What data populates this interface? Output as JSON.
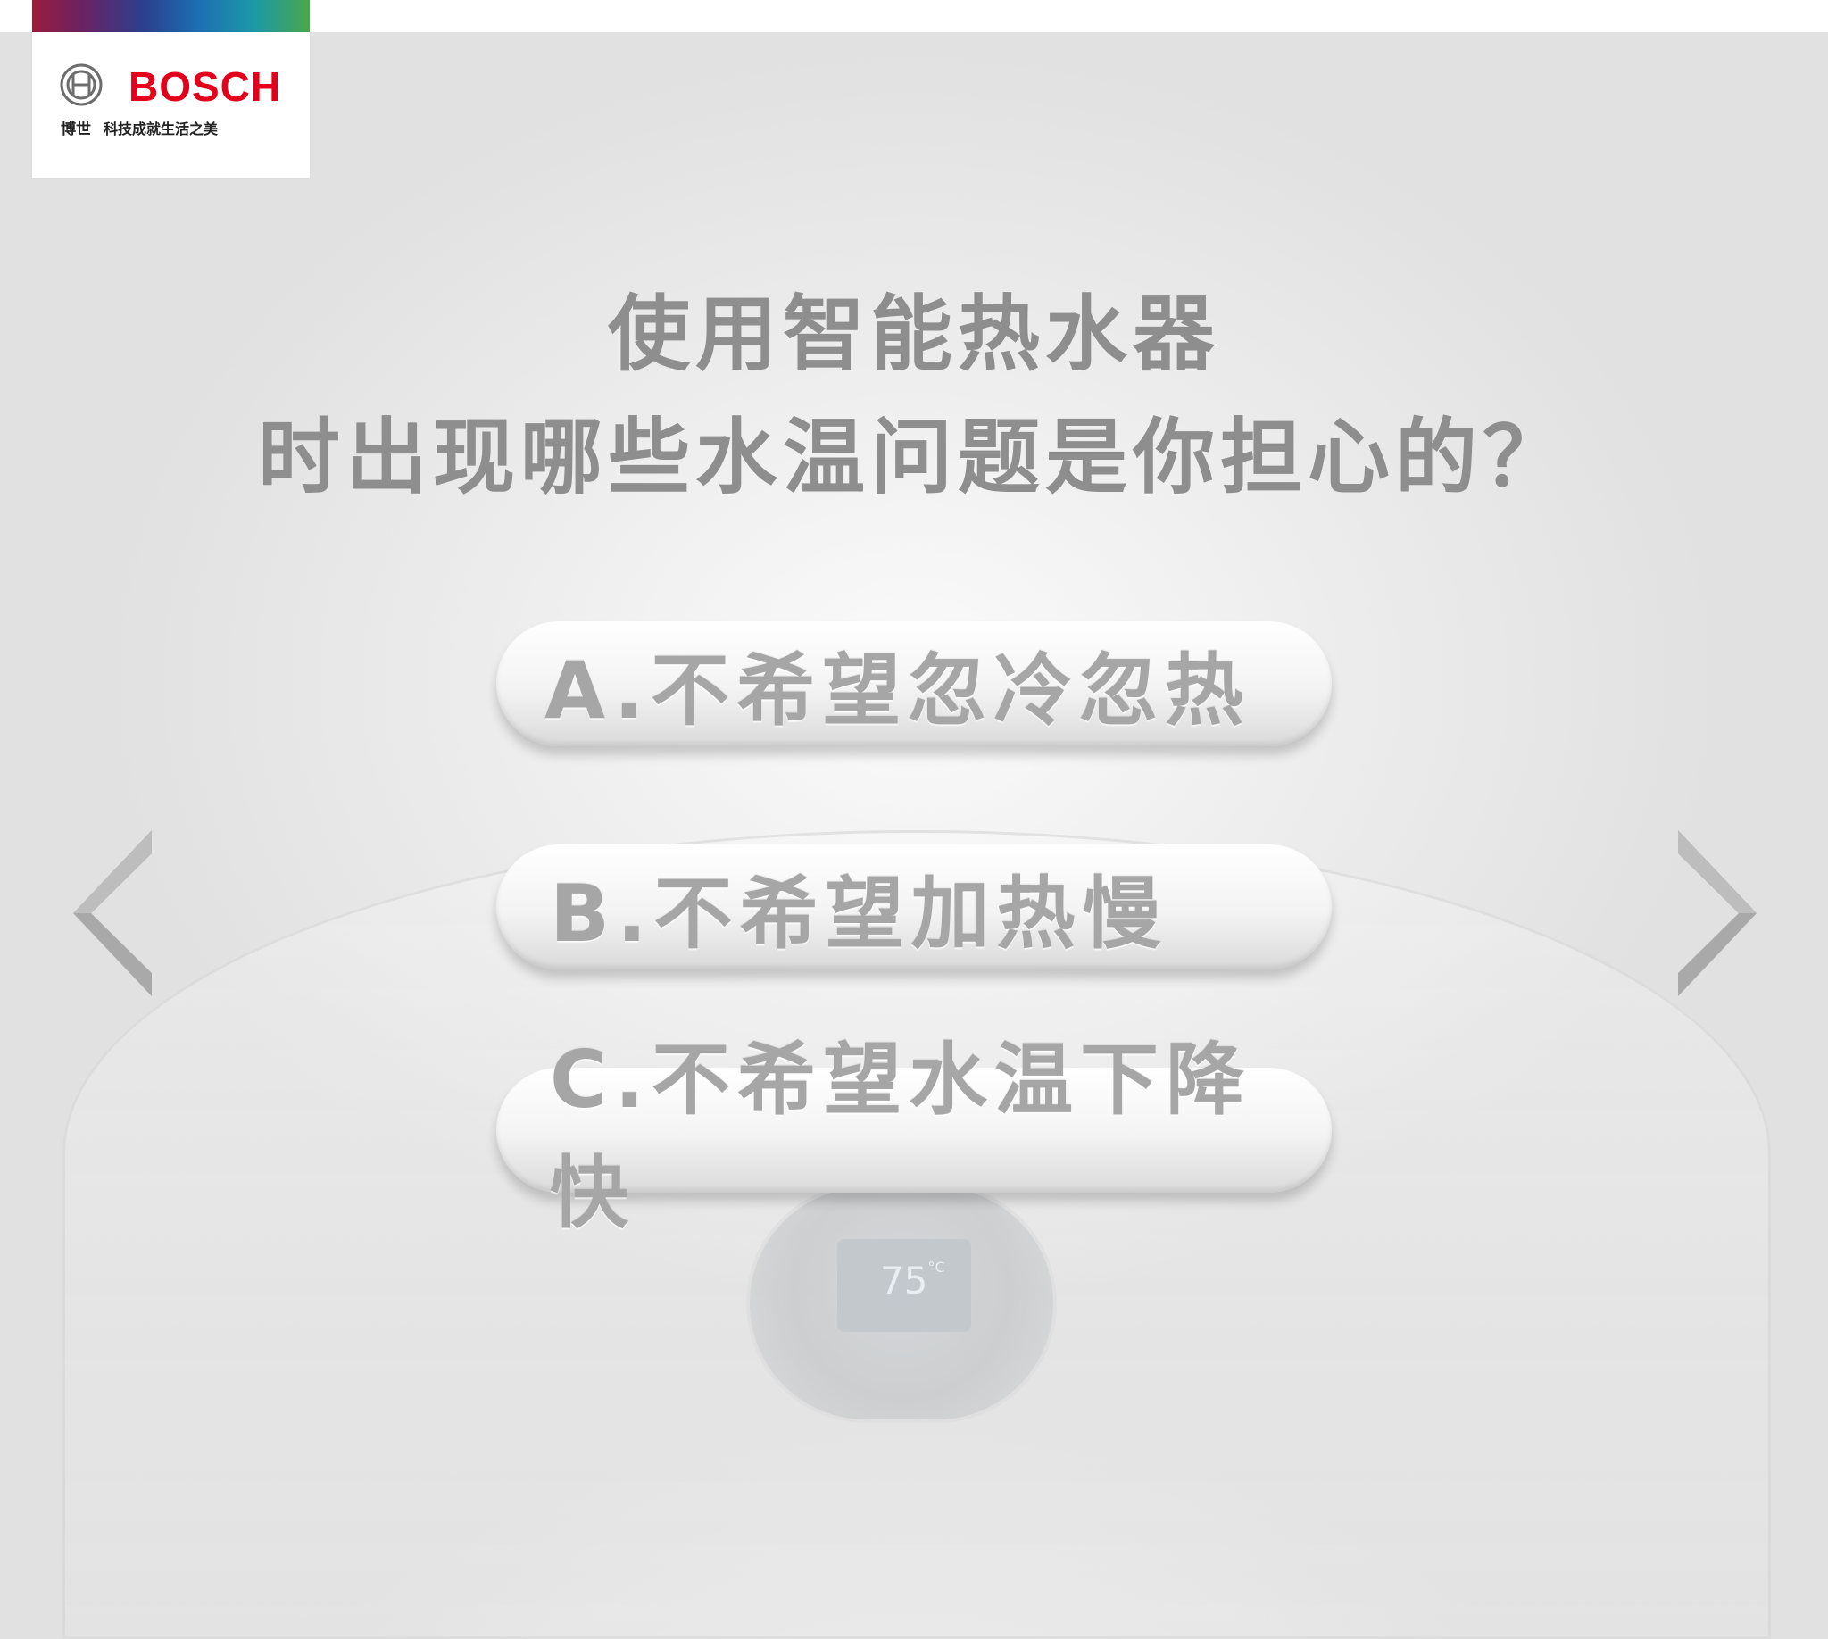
{
  "brand": {
    "name": "BOSCH",
    "chinese_name": "博世",
    "tagline": "科技成就生活之美",
    "red": "#e2001a"
  },
  "question": {
    "line1": "使用智能热水器",
    "line2": "时出现哪些水温问题是你担心的？"
  },
  "options": [
    {
      "label": "A.不希望忽冷忽热"
    },
    {
      "label": "B.不希望加热慢"
    },
    {
      "label": "C.不希望水温下降快"
    }
  ],
  "navigation": {
    "prev_icon": "chevron-left-icon",
    "next_icon": "chevron-right-icon"
  },
  "heater_display": {
    "temperature": "75",
    "unit": "°C"
  }
}
